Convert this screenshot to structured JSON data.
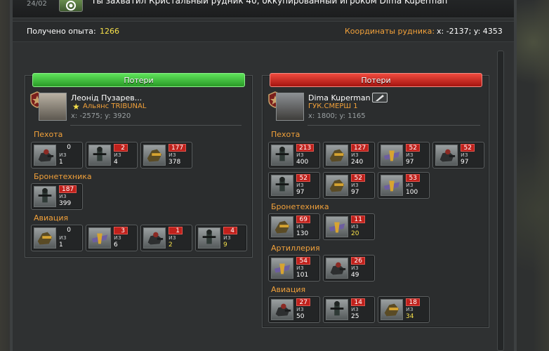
{
  "topbar": {
    "date": "24/02",
    "message": "Ты захватил Кристальный рудник 40, оккупированный игроком Dima Kuperman"
  },
  "info": {
    "xp_label": "Получено опыта:",
    "xp_value": "1266",
    "coords_label": "Координаты рудника:",
    "coords_value": "x: -2137; y: 4353"
  },
  "left_panel": {
    "title": "Потери",
    "player_name": "Леонід Пузарев...",
    "alliance": "Альянс TRIBUNAL",
    "coords": "x: -2575; y: 3920",
    "sections": [
      {
        "name": "Пехота",
        "units": [
          {
            "lost": "0",
            "of": "из",
            "total": "1"
          },
          {
            "lost": "2",
            "of": "из",
            "total": "4"
          },
          {
            "lost": "177",
            "of": "из",
            "total": "378"
          }
        ]
      },
      {
        "name": "Бронетехника",
        "units": [
          {
            "lost": "187",
            "of": "из",
            "total": "399"
          }
        ]
      },
      {
        "name": "Авиация",
        "units": [
          {
            "lost": "0",
            "of": "из",
            "total": "1"
          },
          {
            "lost": "3",
            "of": "из",
            "total": "6"
          },
          {
            "lost": "1",
            "of": "из",
            "total": "2"
          },
          {
            "lost": "4",
            "of": "из",
            "total": "9"
          }
        ]
      }
    ]
  },
  "right_panel": {
    "title": "Потери",
    "player_name": "Dima Kuperman",
    "alliance": "ГУК.СМЕРШ 1",
    "coords": "x: 1800; y: 1165",
    "sections": [
      {
        "name": "Пехота",
        "units": [
          {
            "lost": "213",
            "of": "из",
            "total": "400"
          },
          {
            "lost": "127",
            "of": "из",
            "total": "240"
          },
          {
            "lost": "52",
            "of": "из",
            "total": "97"
          },
          {
            "lost": "52",
            "of": "из",
            "total": "97"
          },
          {
            "lost": "52",
            "of": "из",
            "total": "97"
          },
          {
            "lost": "52",
            "of": "из",
            "total": "97"
          },
          {
            "lost": "53",
            "of": "из",
            "total": "100"
          }
        ]
      },
      {
        "name": "Бронетехника",
        "units": [
          {
            "lost": "69",
            "of": "из",
            "total": "130"
          },
          {
            "lost": "11",
            "of": "из",
            "total": "20"
          }
        ]
      },
      {
        "name": "Артиллерия",
        "units": [
          {
            "lost": "54",
            "of": "из",
            "total": "101"
          },
          {
            "lost": "26",
            "of": "из",
            "total": "49"
          }
        ]
      },
      {
        "name": "Авиация",
        "units": [
          {
            "lost": "27",
            "of": "из",
            "total": "50"
          },
          {
            "lost": "14",
            "of": "из",
            "total": "25"
          },
          {
            "lost": "18",
            "of": "из",
            "total": "34"
          }
        ]
      }
    ]
  },
  "colors": {
    "accent_orange": "#f2a13a",
    "xp_yellow": "#f6e04a",
    "loss_red": "#c0211c",
    "header_green": "#3fc13b",
    "header_red": "#d42a22"
  }
}
